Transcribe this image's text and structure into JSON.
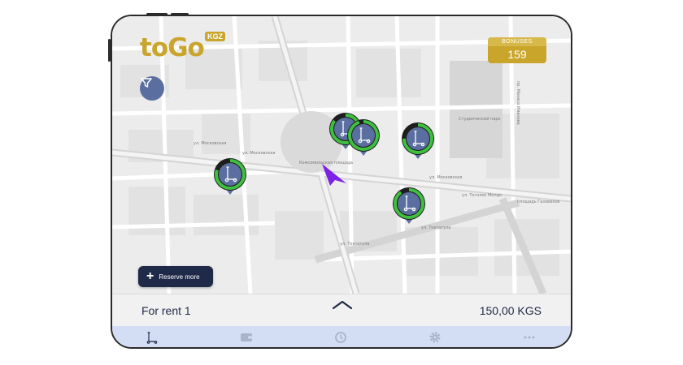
{
  "app": {
    "logo_text": "toGo",
    "logo_sub": "KGZ"
  },
  "bonus": {
    "label": "BONUSES",
    "value": "159"
  },
  "map": {
    "street_labels": [
      "ул. Московская",
      "ул. Московская",
      "Комсомольская площадь",
      "ул. Токтогула",
      "ул. Токтогула",
      "ул. Тоголок Молдо",
      "площадь Газовиков",
      "ул. Московская",
      "Студенческий парк",
      "пр. Манаса Иманова",
      "Комсомольская площадь"
    ]
  },
  "markers": [
    {
      "name": "scooter-marker-1",
      "charge": 0.8
    },
    {
      "name": "scooter-marker-2",
      "charge": 0.85
    },
    {
      "name": "scooter-marker-3",
      "charge": 0.95
    },
    {
      "name": "scooter-marker-4",
      "charge": 0.75
    },
    {
      "name": "scooter-marker-5",
      "charge": 0.9
    }
  ],
  "actions": {
    "reserve_label": "Reserve more"
  },
  "rent": {
    "label": "For rent 1",
    "price": "150,00 KGS"
  },
  "tabs": [
    {
      "icon": "scooter-icon"
    },
    {
      "icon": "wallet-icon"
    },
    {
      "icon": "history-icon"
    },
    {
      "icon": "gear-icon"
    },
    {
      "icon": "more-icon"
    }
  ],
  "colors": {
    "accent_gold": "#c9a52c",
    "navy": "#1f2a48",
    "marker_fill": "#5a6fa0",
    "charge_green": "#3fbf3f",
    "cursor_purple": "#7b22e6",
    "tabbar": "#d3def4"
  }
}
